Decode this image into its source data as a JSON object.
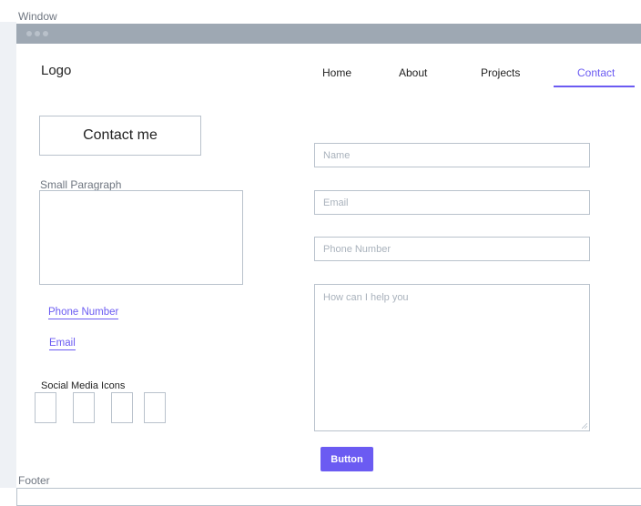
{
  "window": {
    "label": "Window"
  },
  "header": {
    "logo": "Logo",
    "nav": [
      {
        "label": "Home"
      },
      {
        "label": "About"
      },
      {
        "label": "Projects"
      },
      {
        "label": "Contact",
        "active": true
      }
    ]
  },
  "left": {
    "title": "Contact me",
    "paragraph_label": "Small Paragraph",
    "phone_link": "Phone Number",
    "email_link": "Email",
    "social_label": "Social Media Icons",
    "social_icon_count": 4
  },
  "form": {
    "name_placeholder": "Name",
    "email_placeholder": "Email",
    "phone_placeholder": "Phone Number",
    "message_placeholder": "How can I help you",
    "button_label": "Button"
  },
  "footer": {
    "label": "Footer"
  },
  "colors": {
    "accent": "#6b5bf2",
    "titlebar": "#9ea8b3",
    "border": "#b9c2cc"
  }
}
